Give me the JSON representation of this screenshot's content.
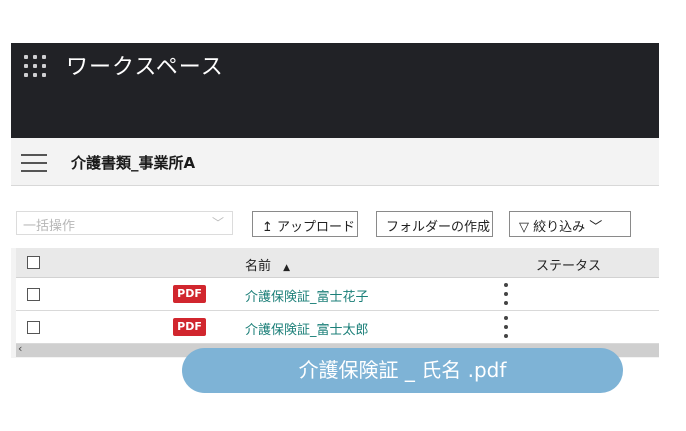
{
  "header": {
    "title": "ワークスペース"
  },
  "subheader": {
    "folder_title": "介護書類_事業所A"
  },
  "toolbar": {
    "bulk_placeholder": "一括操作",
    "upload_icon": "↥",
    "upload_label": "アップロード",
    "new_folder_label": "フォルダーの作成",
    "filter_icon": "▽",
    "filter_label": "絞り込み",
    "filter_chevron": "﹀"
  },
  "table": {
    "columns": {
      "name": "名前",
      "sort_indicator": "▲",
      "status": "ステータス"
    },
    "rows": [
      {
        "badge": "PDF",
        "name": "介護保険証_富士花子"
      },
      {
        "badge": "PDF",
        "name": "介護保険証_富士太郎"
      }
    ]
  },
  "scrollbar": {
    "left_arrow": "‹"
  },
  "overlay": {
    "filename": "介護保険証 _ 氏名 .pdf"
  }
}
